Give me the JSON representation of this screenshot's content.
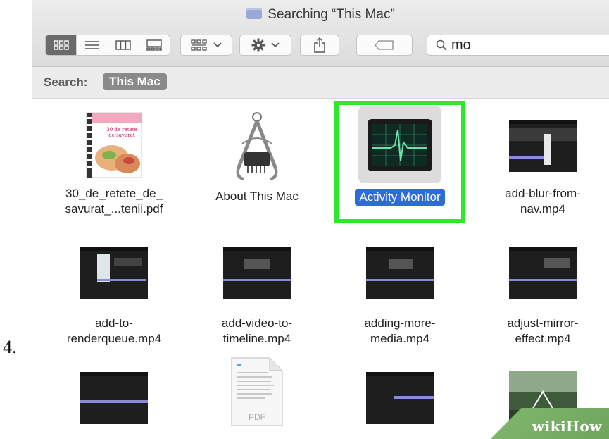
{
  "step_number": "4.",
  "window": {
    "title": "Searching “This Mac”",
    "title_icon": "folder-icon"
  },
  "toolbar": {
    "view_modes": [
      {
        "name": "icon-view",
        "icon": "icon-grid-icon",
        "active": true
      },
      {
        "name": "list-view",
        "icon": "list-icon",
        "active": false
      },
      {
        "name": "column-view",
        "icon": "columns-icon",
        "active": false
      },
      {
        "name": "gallery-view",
        "icon": "gallery-icon",
        "active": false
      }
    ],
    "group_icon": "group-by-icon",
    "action_icon": "gear-icon",
    "share_icon": "share-icon",
    "tag_icon": "tag-icon",
    "search": {
      "value": "mo",
      "icon": "search-icon"
    }
  },
  "scope": {
    "label": "Search:",
    "token": "This Mac"
  },
  "files": {
    "row1": [
      {
        "name_line1": "30_de_retete_de_",
        "name_line2": "savurat_...tenii.pdf",
        "kind": "pdf-cover"
      },
      {
        "name_line1": "About This Mac",
        "name_line2": "",
        "kind": "app-about"
      },
      {
        "name_line1": "Activity Monitor",
        "name_line2": "",
        "kind": "app-activity",
        "selected": true
      },
      {
        "name_line1": "add-blur-from-",
        "name_line2": "nav.mp4",
        "kind": "video"
      }
    ],
    "row2": [
      {
        "name_line1": "add-to-",
        "name_line2": "renderqueue.mp4",
        "kind": "video"
      },
      {
        "name_line1": "add-video-to-",
        "name_line2": "timeline.mp4",
        "kind": "video"
      },
      {
        "name_line1": "adding-more-",
        "name_line2": "media.mp4",
        "kind": "video"
      },
      {
        "name_line1": "adjust-mirror-",
        "name_line2": "effect.mp4",
        "kind": "video"
      }
    ],
    "row3": [
      {
        "kind": "video"
      },
      {
        "kind": "pdf-doc",
        "label": "PDF"
      },
      {
        "kind": "video"
      },
      {
        "kind": "photo"
      }
    ]
  },
  "highlight_color": "#2ee82e",
  "selection_color": "#2d6bd6",
  "watermark": "wikiHow"
}
